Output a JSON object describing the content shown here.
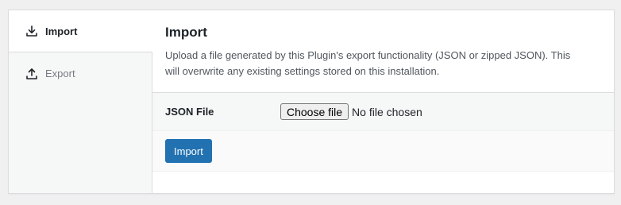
{
  "tabs": [
    {
      "label": "Import",
      "icon": "download-icon",
      "active": true
    },
    {
      "label": "Export",
      "icon": "upload-icon",
      "active": false
    }
  ],
  "section": {
    "title": "Import",
    "description": "Upload a file generated by this Plugin's export functionality (JSON or zipped JSON). This will overwrite any existing settings stored on this installation."
  },
  "field": {
    "label": "JSON File",
    "button_label": "Choose file",
    "status": "No file chosen"
  },
  "actions": {
    "submit_label": "Import"
  },
  "colors": {
    "accent": "#2271b1",
    "background": "#f0f0f1"
  }
}
